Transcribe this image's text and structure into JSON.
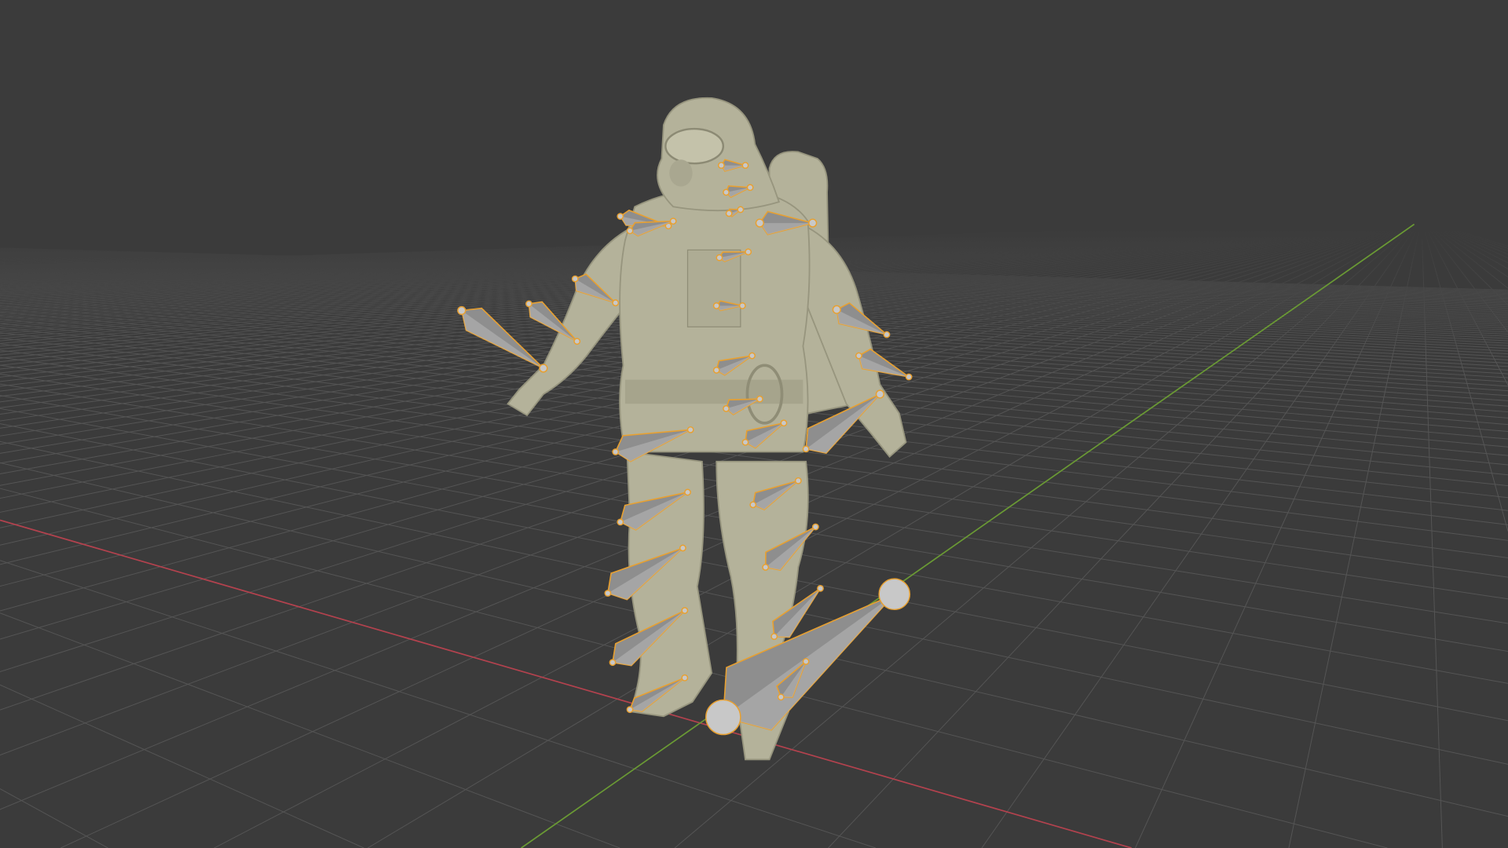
{
  "viewport": {
    "mode": "3d-viewport",
    "background_color": "#3b3b3b",
    "grid_color": "#555555",
    "x_axis_color": "#b3424e",
    "y_axis_color": "#6a9a34",
    "mesh_color": "#b4b29a",
    "bone_fill_color": "#8e8e8e",
    "bone_outline_color": "#e8a030"
  }
}
